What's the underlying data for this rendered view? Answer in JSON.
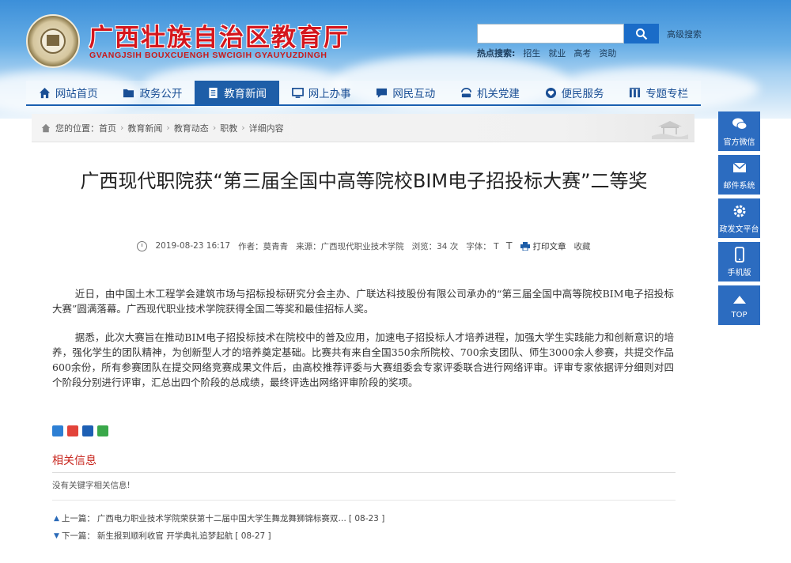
{
  "header": {
    "title": "广西壮族自治区教育厅",
    "subtitle": "GVANGJSIH BOUXCUENGH SWCIGIH GYAUYUZDINGH",
    "search": {
      "placeholder": "",
      "advanced_label": "高级搜索"
    },
    "hot_search": {
      "label": "热点搜索:",
      "items": [
        "招生",
        "就业",
        "高考",
        "资助"
      ]
    }
  },
  "nav": {
    "items": [
      {
        "label": "网站首页",
        "icon": "home-icon"
      },
      {
        "label": "政务公开",
        "icon": "folder-icon"
      },
      {
        "label": "教育新闻",
        "icon": "document-icon",
        "active": true
      },
      {
        "label": "网上办事",
        "icon": "monitor-icon"
      },
      {
        "label": "网民互动",
        "icon": "chat-icon"
      },
      {
        "label": "机关党建",
        "icon": "bell-icon"
      },
      {
        "label": "便民服务",
        "icon": "heart-icon"
      },
      {
        "label": "专题专栏",
        "icon": "columns-icon"
      }
    ],
    "active_color": "#1e5ea8"
  },
  "breadcrumb": {
    "label": "您的位置：",
    "items": [
      "首页",
      "教育新闻",
      "教育动态",
      "职教",
      "详细内容"
    ]
  },
  "article": {
    "title": "广西现代职院获“第三届全国中高等院校BIM电子招投标大赛”二等奖",
    "meta": {
      "date": "2019-08-23 16:17",
      "author": "作者：莫青青",
      "source": "来源：广西现代职业技术学院",
      "views": "浏览：34 次",
      "font_label": "字体：",
      "font_small": "T",
      "font_large": "T",
      "print": "打印文章",
      "favorite": "收藏"
    },
    "paragraphs": [
      "近日，由中国土木工程学会建筑市场与招标投标研究分会主办、广联达科技股份有限公司承办的“第三届全国中高等院校BIM电子招投标大赛”圆满落幕。广西现代职业技术学院获得全国二等奖和最佳招标人奖。",
      "据悉，此次大赛旨在推动BIM电子招投标技术在院校中的普及应用，加速电子招投标人才培养进程，加强大学生实践能力和创新意识的培养，强化学生的团队精神，为创新型人才的培养奠定基础。比赛共有来自全国350余所院校、700余支团队、师生3000余人参赛，共提交作品600余份，所有参赛团队在提交网络竞赛成果文件后，由高校推荐评委与大赛组委会专家评委联合进行网络评审。评审专家依据评分细则对四个阶段分别进行评审，汇总出四个阶段的总成绩，最终评选出网络评审阶段的奖项。"
    ]
  },
  "share": {
    "icons": [
      "qzone-share-icon",
      "weibo-share-icon",
      "renren-share-icon",
      "wechat-share-icon"
    ]
  },
  "related": {
    "title": "相关信息",
    "empty": "没有关键字相关信息!"
  },
  "prev": {
    "label": "上一篇：",
    "title": "广西电力职业技术学院荣获第十二届中国大学生舞龙舞狮锦标赛双…",
    "date": "[ 08-23 ]"
  },
  "next": {
    "label": "下一篇：",
    "title": "新生报到顺利收官 开学典礼追梦起航",
    "date": "[ 08-27 ]"
  },
  "floatbar": {
    "items": [
      {
        "label": "官方微信",
        "icon": "wechat-icon"
      },
      {
        "label": "邮件系统",
        "icon": "mail-icon"
      },
      {
        "label": "政发文平台",
        "icon": "gear-icon"
      },
      {
        "label": "手机版",
        "icon": "mobile-icon"
      },
      {
        "label": "TOP",
        "icon": "arrow-up-icon"
      }
    ],
    "color": "#2c6cc0"
  }
}
